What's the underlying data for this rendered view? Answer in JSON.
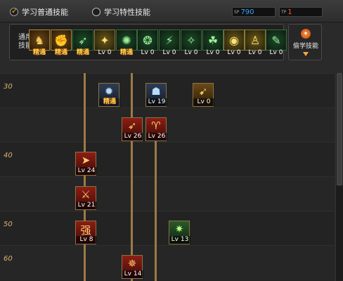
{
  "header": {
    "mode_general": "学习普通技能",
    "mode_special": "学习特性技能",
    "sp_tag": "SP",
    "sp_value": "790",
    "tp_tag": "TP",
    "tp_value": "1"
  },
  "skillbar": {
    "label": "通用技能",
    "slots": [
      {
        "glyph": "♞",
        "label": "精通",
        "mastered": true,
        "style": "gold"
      },
      {
        "glyph": "✊",
        "label": "精通",
        "mastered": true,
        "style": "gold"
      },
      {
        "glyph": "➶",
        "label": "精通",
        "mastered": true,
        "style": "green"
      },
      {
        "glyph": "✦",
        "label": "Lv 0",
        "mastered": false,
        "style": "amber"
      },
      {
        "glyph": "✺",
        "label": "精通",
        "mastered": true,
        "style": "green"
      },
      {
        "glyph": "❂",
        "label": "Lv 0",
        "mastered": false,
        "style": "green"
      },
      {
        "glyph": "⚡",
        "label": "Lv 0",
        "mastered": false,
        "style": "green"
      },
      {
        "glyph": "✧",
        "label": "Lv 0",
        "mastered": false,
        "style": "green"
      },
      {
        "glyph": "☘",
        "label": "Lv 0",
        "mastered": false,
        "style": "green"
      },
      {
        "glyph": "◉",
        "label": "Lv 0",
        "mastered": false,
        "style": "amber"
      },
      {
        "glyph": "♙",
        "label": "Lv 0",
        "mastered": false,
        "style": "amber"
      },
      {
        "glyph": "✎",
        "label": "Lv 0",
        "mastered": false,
        "style": "green"
      }
    ],
    "steal_label": "偷学技能"
  },
  "tree": {
    "levels": [
      "30",
      "40",
      "50",
      "60"
    ],
    "nodes": [
      {
        "glyph": "✹",
        "label": "精通",
        "mastered": true,
        "style": "blue"
      },
      {
        "glyph": "☗",
        "label": "Lv 19",
        "mastered": false,
        "style": "blue"
      },
      {
        "glyph": "➹",
        "label": "Lv 0",
        "mastered": false,
        "style": "gold"
      },
      {
        "glyph": "➶",
        "label": "Lv 26",
        "mastered": false,
        "style": "red"
      },
      {
        "glyph": "♈",
        "label": "Lv 26",
        "mastered": false,
        "style": "red"
      },
      {
        "glyph": "➤",
        "label": "Lv 24",
        "mastered": false,
        "style": "red"
      },
      {
        "glyph": "⚔",
        "label": "Lv 21",
        "mastered": false,
        "style": "red"
      },
      {
        "glyph": "强",
        "label": "Lv 8",
        "mastered": false,
        "style": "red"
      },
      {
        "glyph": "✷",
        "label": "Lv 13",
        "mastered": false,
        "style": "green"
      },
      {
        "glyph": "✵",
        "label": "Lv 14",
        "mastered": false,
        "style": "red"
      }
    ]
  }
}
